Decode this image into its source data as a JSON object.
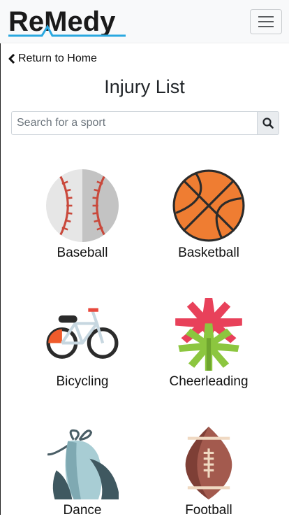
{
  "navbar": {
    "brand": "ReMedy",
    "toggle_label": "Toggle navigation"
  },
  "back_link": {
    "label": "Return to Home"
  },
  "page_title": "Injury List",
  "search": {
    "placeholder": "Search for a sport",
    "value": ""
  },
  "sports": [
    {
      "label": "Baseball",
      "icon": "baseball-icon"
    },
    {
      "label": "Basketball",
      "icon": "basketball-icon"
    },
    {
      "label": "Bicycling",
      "icon": "bicycle-icon"
    },
    {
      "label": "Cheerleading",
      "icon": "pompom-icon"
    },
    {
      "label": "Dance",
      "icon": "ballet-shoes-icon"
    },
    {
      "label": "Football",
      "icon": "football-icon"
    }
  ],
  "colors": {
    "brand_text": "#1a1a1a",
    "brand_accent": "#29a8e0",
    "navbar_bg": "#f8f9fa"
  }
}
